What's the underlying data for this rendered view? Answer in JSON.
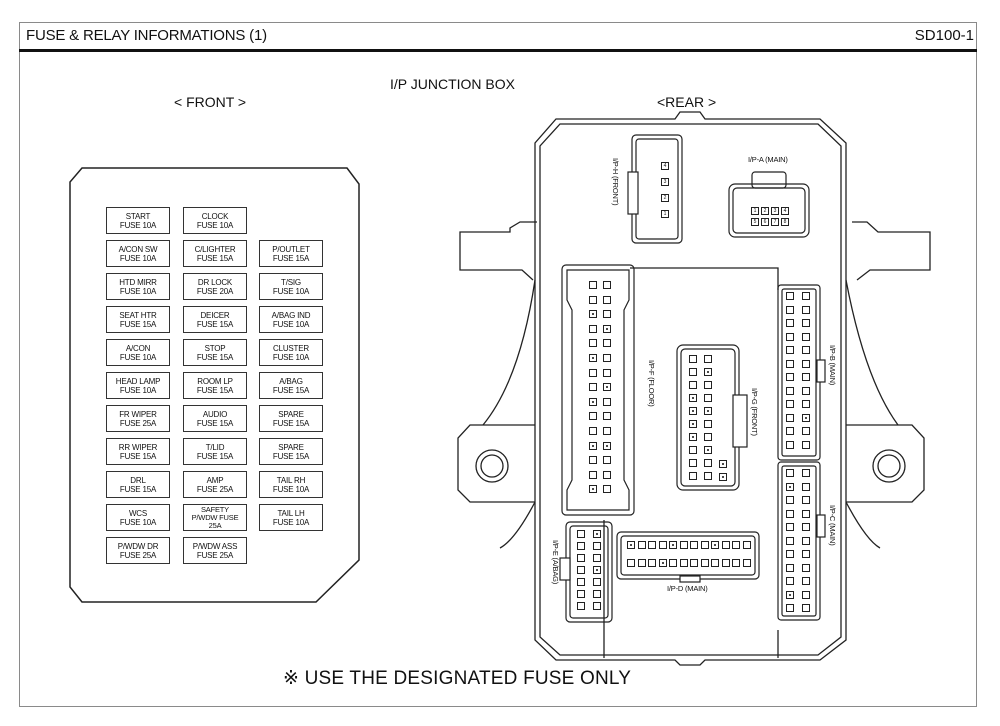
{
  "header": {
    "title": "FUSE & RELAY INFORMATIONS (1)",
    "code": "SD100-1"
  },
  "diagram": {
    "title": "I/P JUNCTION BOX",
    "front_label": "< FRONT >",
    "rear_label": "<REAR >",
    "note_symbol": "※",
    "note": "USE THE DESIGNATED FUSE ONLY"
  },
  "fuses": [
    {
      "name": "START",
      "rating": "FUSE 10A"
    },
    {
      "name": "CLOCK",
      "rating": "FUSE 10A"
    },
    null,
    {
      "name": "A/CON SW",
      "rating": "FUSE 10A"
    },
    {
      "name": "C/LIGHTER",
      "rating": "FUSE 15A"
    },
    {
      "name": "P/OUTLET",
      "rating": "FUSE 15A"
    },
    {
      "name": "HTD MIRR",
      "rating": "FUSE 10A"
    },
    {
      "name": "DR  LOCK",
      "rating": "FUSE 20A"
    },
    {
      "name": "T/SIG",
      "rating": "FUSE 10A"
    },
    {
      "name": "SEAT HTR",
      "rating": "FUSE 15A"
    },
    {
      "name": "DEICER",
      "rating": "FUSE 15A"
    },
    {
      "name": "A/BAG IND",
      "rating": "FUSE 10A"
    },
    {
      "name": "A/CON",
      "rating": "FUSE 10A"
    },
    {
      "name": "STOP",
      "rating": "FUSE 15A"
    },
    {
      "name": "CLUSTER",
      "rating": "FUSE 10A"
    },
    {
      "name": "HEAD LAMP",
      "rating": "FUSE 10A"
    },
    {
      "name": "ROOM LP",
      "rating": "FUSE 15A"
    },
    {
      "name": "A/BAG",
      "rating": "FUSE 15A"
    },
    {
      "name": "FR WIPER",
      "rating": "FUSE 25A"
    },
    {
      "name": "AUDIO",
      "rating": "FUSE 15A"
    },
    {
      "name": "SPARE",
      "rating": "FUSE 15A"
    },
    {
      "name": "RR WIPER",
      "rating": "FUSE 15A"
    },
    {
      "name": "T/LID",
      "rating": "FUSE 15A"
    },
    {
      "name": "SPARE",
      "rating": "FUSE 15A"
    },
    {
      "name": "DRL",
      "rating": "FUSE 15A"
    },
    {
      "name": "AMP",
      "rating": "FUSE 25A"
    },
    {
      "name": "TAIL RH",
      "rating": "FUSE 10A"
    },
    {
      "name": "WCS",
      "rating": "FUSE 10A"
    },
    {
      "name": "SAFETY",
      "name2": "P/WDW FUSE",
      "rating": "25A"
    },
    {
      "name": "TAIL LH",
      "rating": "FUSE 10A"
    },
    {
      "name": "P/WDW DR",
      "rating": "FUSE 25A"
    },
    {
      "name": "P/WDW ASS",
      "rating": "FUSE 25A"
    },
    null
  ],
  "connectors": {
    "ip_a": {
      "label": "I/P-A (MAIN)",
      "pins": [
        "1",
        "2",
        "3",
        "4",
        "5",
        "6",
        "7",
        "8"
      ]
    },
    "ip_b": {
      "label": "I/P-B (MAIN)"
    },
    "ip_c": {
      "label": "I/P-C (MAIN)"
    },
    "ip_d": {
      "label": "I/P-D (MAIN)"
    },
    "ip_e": {
      "label": "I/P-E (A/BAG)"
    },
    "ip_f": {
      "label": "I/P-F (FLOOR)"
    },
    "ip_g": {
      "label": "I/P-G (FRONT)"
    },
    "ip_h": {
      "label": "I/P-H (FRONT)",
      "pins": [
        "4",
        "3",
        "2",
        "1"
      ]
    }
  }
}
